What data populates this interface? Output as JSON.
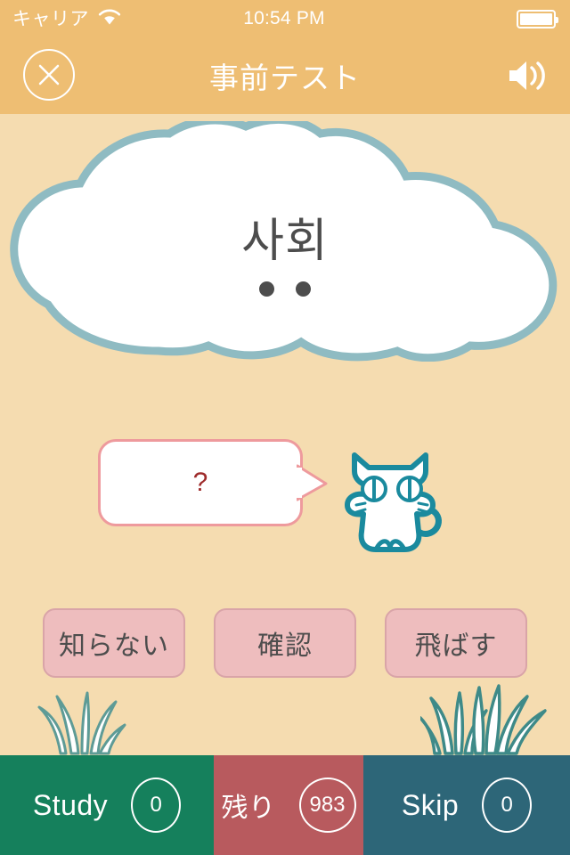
{
  "status_bar": {
    "carrier": "キャリア",
    "wifi_icon": "wifi-icon",
    "time": "10:54 PM",
    "battery_icon": "battery-full-icon"
  },
  "nav_bar": {
    "close_icon": "close-x-icon",
    "title": "事前テスト",
    "sound_icon": "speaker-volume-icon"
  },
  "question_card": {
    "word": "사회",
    "reading_dots": "••"
  },
  "prompt": {
    "bubble_text": "?",
    "character_icon": "cat-mascot-icon"
  },
  "answer_buttons": [
    {
      "label": "知らない",
      "name": "dont-know-button"
    },
    {
      "label": "確認",
      "name": "confirm-button"
    },
    {
      "label": "飛ばす",
      "name": "skip-word-button"
    }
  ],
  "decorations": {
    "grass_left_icon": "grass-tuft-icon",
    "grass_right_icon": "grass-cluster-icon"
  },
  "bottom_bar": {
    "study": {
      "label": "Study",
      "count": "0"
    },
    "remaining": {
      "label": "残り",
      "count": "983"
    },
    "skip": {
      "label": "Skip",
      "count": "0"
    }
  },
  "colors": {
    "header": "#EEBE73",
    "background": "#F5DCB0",
    "cloud_border": "#8FBBC2",
    "cloud_fill": "#FFFFFF",
    "bubble_border": "#EE9A9D",
    "question_mark": "#9E2B2B",
    "cat_outline": "#1A8A9E",
    "answer_button": "#EEBDBE",
    "study_green": "#15805C",
    "remaining_red": "#B85A5E",
    "skip_teal": "#2D6678",
    "text_dark": "#4D4D4D"
  }
}
